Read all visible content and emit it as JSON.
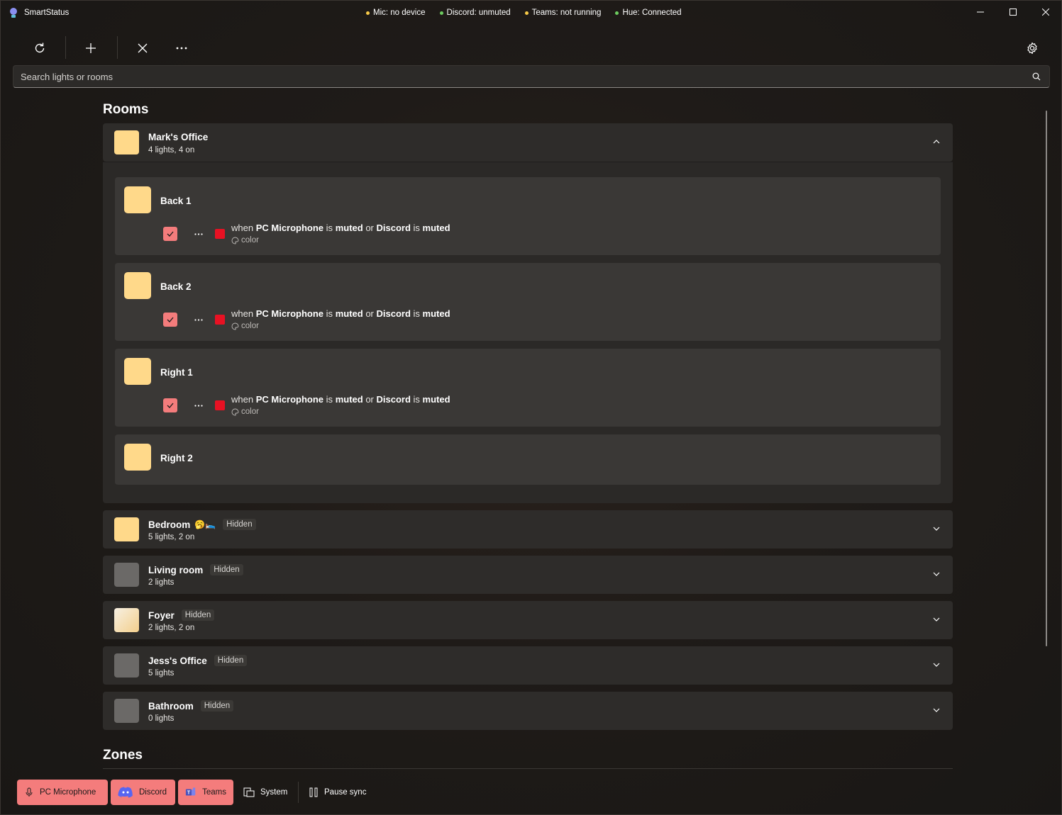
{
  "app": {
    "title": "SmartStatus"
  },
  "statuses": [
    {
      "label": "Mic: no device",
      "color": "#f7c948"
    },
    {
      "label": "Discord: unmuted",
      "color": "#6ccb5f"
    },
    {
      "label": "Teams: not running",
      "color": "#f7c948"
    },
    {
      "label": "Hue: Connected",
      "color": "#6ccb5f"
    }
  ],
  "toolbar": {
    "refresh_icon": "refresh-icon",
    "add_icon": "plus-icon",
    "remove_icon": "close-icon",
    "more_icon": "more-icon",
    "settings_icon": "gear-icon"
  },
  "search": {
    "placeholder": "Search lights or rooms"
  },
  "sections": {
    "rooms": "Rooms",
    "zones": "Zones"
  },
  "expanded_room": {
    "name": "Mark's Office",
    "subtitle": "4 lights, 4 on",
    "color": "#ffd98a",
    "lights": [
      {
        "name": "Back 1",
        "has_rule": true
      },
      {
        "name": "Back 2",
        "has_rule": true
      },
      {
        "name": "Right 1",
        "has_rule": true
      },
      {
        "name": "Right 2",
        "has_rule": false
      }
    ],
    "rule": {
      "when": "when",
      "source1": "PC Microphone",
      "is1": "is",
      "state1": "muted",
      "or": "or",
      "source2": "Discord",
      "is2": "is",
      "state2": "muted",
      "action": "color",
      "color": "#e81123"
    }
  },
  "rooms": [
    {
      "name": "Bedroom",
      "emoji": "🥱🛌",
      "badge": "Hidden",
      "subtitle": "5 lights, 2 on",
      "color": "#ffd98a"
    },
    {
      "name": "Living room",
      "emoji": "",
      "badge": "Hidden",
      "subtitle": "2 lights",
      "color": "#6b6967"
    },
    {
      "name": "Foyer",
      "emoji": "",
      "badge": "Hidden",
      "subtitle": "2 lights, 2 on",
      "color": "#f5deb0"
    },
    {
      "name": "Jess's Office",
      "emoji": "",
      "badge": "Hidden",
      "subtitle": "5 lights",
      "color": "#6b6967"
    },
    {
      "name": "Bathroom",
      "emoji": "",
      "badge": "Hidden",
      "subtitle": "0 lights",
      "color": "#6b6967"
    }
  ],
  "bottom": {
    "pc_microphone": "PC Microphone",
    "discord": "Discord",
    "teams": "Teams",
    "system": "System",
    "pause_sync": "Pause sync"
  }
}
